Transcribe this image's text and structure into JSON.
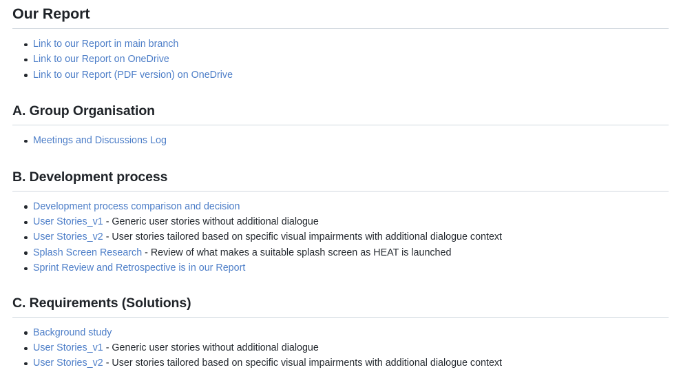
{
  "document": {
    "title": "Our Report"
  },
  "sections": [
    {
      "id": "our-report",
      "heading": "Our Report",
      "items": [
        {
          "link": "Link to our Report in main branch",
          "desc": ""
        },
        {
          "link": "Link to our Report on OneDrive",
          "desc": ""
        },
        {
          "link": "Link to our Report (PDF version) on OneDrive",
          "desc": ""
        }
      ]
    },
    {
      "id": "group-organisation",
      "heading": "A. Group Organisation",
      "items": [
        {
          "link": "Meetings and Discussions Log",
          "desc": ""
        }
      ]
    },
    {
      "id": "development-process",
      "heading": "B. Development process",
      "items": [
        {
          "link": "Development process comparison and decision",
          "desc": ""
        },
        {
          "link": "User Stories_v1",
          "desc": " - Generic user stories without additional dialogue"
        },
        {
          "link": "User Stories_v2",
          "desc": " - User stories tailored based on specific visual impairments with additional dialogue context"
        },
        {
          "link": "Splash Screen Research",
          "desc": " - Review of what makes a suitable splash screen as HEAT is launched"
        },
        {
          "link": "Sprint Review and Retrospective is in our Report",
          "desc": ""
        }
      ]
    },
    {
      "id": "requirements-solutions",
      "heading": "C. Requirements (Solutions)",
      "items": [
        {
          "link": "Background study",
          "desc": ""
        },
        {
          "link": "User Stories_v1",
          "desc": " - Generic user stories without additional dialogue"
        },
        {
          "link": "User Stories_v2",
          "desc": " - User stories tailored based on specific visual impairments with additional dialogue context"
        }
      ]
    }
  ],
  "colors": {
    "link": "#4d7ec8",
    "heading": "#1f2328",
    "body_text": "#24292f",
    "rule": "#d0d7de",
    "background": "#ffffff"
  }
}
